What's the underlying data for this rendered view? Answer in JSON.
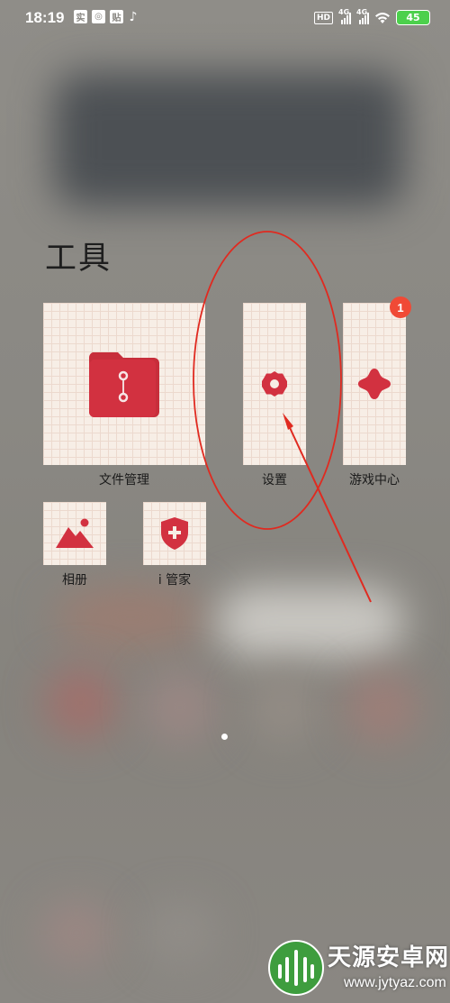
{
  "status_bar": {
    "time": "18:19",
    "notif_icons": [
      "实",
      "◎",
      "贴"
    ],
    "tiktok_icon": "♪",
    "hd_label": "HD",
    "sim1_label": "4G",
    "sim2_label": "4G",
    "battery": "45"
  },
  "folder": {
    "title": "工具",
    "apps": [
      {
        "id": "file-manager",
        "label": "文件管理",
        "icon": "folder-icon"
      },
      {
        "id": "settings",
        "label": "设置",
        "icon": "gear-icon"
      },
      {
        "id": "game-center",
        "label": "游戏中心",
        "icon": "game-icon",
        "badge": "1"
      },
      {
        "id": "album",
        "label": "相册",
        "icon": "mountain-icon"
      },
      {
        "id": "i-manager",
        "label": "i 管家",
        "icon": "shield-icon"
      }
    ]
  },
  "annotation": {
    "color": "#e02a20"
  },
  "page_indicator": {
    "count": 1,
    "active": 0
  },
  "watermark": {
    "name": "天源安卓网",
    "url": "www.jytyaz.com"
  },
  "colors": {
    "icon_red": "#d23140",
    "tile_bg": "#f7eee6",
    "badge": "#f04a36"
  }
}
